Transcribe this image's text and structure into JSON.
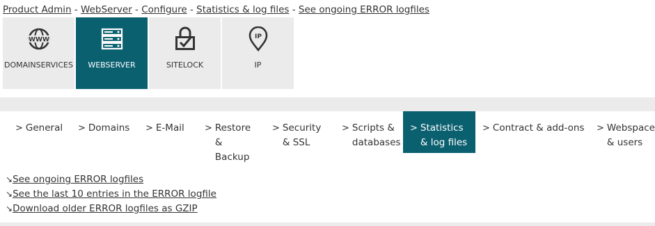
{
  "breadcrumb": {
    "items": [
      "Product Admin",
      "WebServer",
      "Configure",
      "Statistics & log files",
      "See ongoing ERROR logfiles"
    ],
    "separator": "-"
  },
  "services": [
    {
      "label": "DOMAINSERVICES",
      "icon": "www-globe-icon",
      "active": false
    },
    {
      "label": "WEBSERVER",
      "icon": "server-icon",
      "active": true
    },
    {
      "label": "SITELOCK",
      "icon": "lock-check-icon",
      "active": false
    },
    {
      "label": "IP",
      "icon": "ip-pin-icon",
      "active": false
    }
  ],
  "tabs": [
    {
      "label": "General",
      "active": false
    },
    {
      "label": "Domains",
      "active": false
    },
    {
      "label": "E-Mail",
      "active": false
    },
    {
      "label": "Restore & Backup",
      "active": false
    },
    {
      "label": "Security & SSL",
      "active": false
    },
    {
      "label": "Scripts & databases",
      "active": false
    },
    {
      "label": "Statistics & log files",
      "active": true
    },
    {
      "label": "Contract & add-ons",
      "active": false
    },
    {
      "label": "Webspace & users",
      "active": false
    }
  ],
  "tab_chevron": ">",
  "links": {
    "arrow": "↘",
    "items": [
      "See ongoing ERROR logfiles",
      "See the last 10 entries in the ERROR logfile",
      "Download older ERROR logfiles as GZIP"
    ]
  },
  "colors": {
    "accent": "#0b6070",
    "tile_bg": "#ebebeb",
    "text": "#333333"
  }
}
